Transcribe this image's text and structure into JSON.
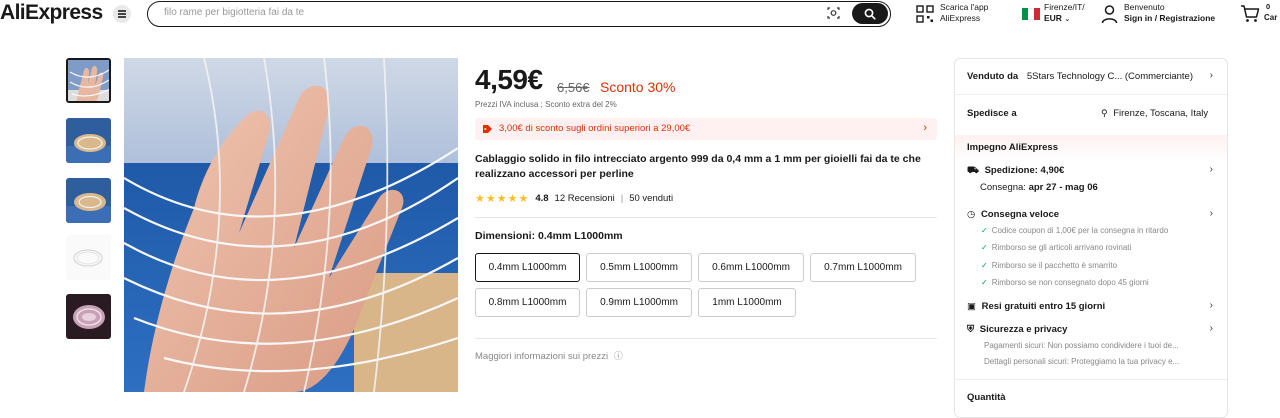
{
  "header": {
    "logo": "AliExpress",
    "search_placeholder": "filo rame per bigiotteria fai da te",
    "app_line1": "Scarica l'app",
    "app_line2": "AliExpress",
    "locale_line1": "Firenze/IT/",
    "locale_line2": "EUR",
    "account_line1": "Benvenuto",
    "account_line2": "Sign in / Registrazione",
    "cart_count": "0",
    "cart_label": "Car"
  },
  "product": {
    "price": "4,59€",
    "old_price": "6,56€",
    "discount": "Sconto 30%",
    "tax_note": "Prezzi IVA inclusa ; Sconto extra del 2%",
    "coupon": "3,00€ di sconto sugli ordini superiori a 29,00€",
    "title": "Cablaggio solido in filo intrecciato argento 999 da 0,4 mm a 1 mm per gioielli fai da te che realizzano accessori per perline",
    "rating": "4.8",
    "reviews": "12 Recensioni",
    "separator": "|",
    "sold": "50 venduti",
    "dimension_label": "Dimensioni: 0.4mm L1000mm",
    "options": [
      "0.4mm L1000mm",
      "0.5mm L1000mm",
      "0.6mm L1000mm",
      "0.7mm L1000mm",
      "0.8mm L1000mm",
      "0.9mm L1000mm",
      "1mm L1000mm"
    ],
    "more_info": "Maggiori informazioni sui prezzi"
  },
  "panel": {
    "sold_by_label": "Venduto da",
    "seller": "5Stars Technology C... (Commerciante)",
    "ships_to_label": "Spedisce a",
    "location": "Firenze, Toscana, Italy",
    "commitment": "Impegno AliExpress",
    "shipping": "Spedizione: 4,90€",
    "delivery_label": "Consegna:",
    "delivery_dates": "apr 27 - mag 06",
    "fast_delivery": "Consegna veloce",
    "fast_items": [
      "Codice coupon di 1,00€ per la consegna in ritardo",
      "Rimborso se gli articoli arrivano rovinati",
      "Rimborso se il pacchetto è smarrito",
      "Rimborso se non consegnato dopo 45 giorni"
    ],
    "free_returns": "Resi gratuiti entro 15 giorni",
    "security": "Sicurezza e privacy",
    "security_items": [
      "Pagamenti sicuri: Non possiamo condividere i tuoi de...",
      "Dettagli personali sicuri: Proteggiamo la tua privacy e..."
    ],
    "quantity": "Quantità"
  },
  "colors": {
    "accent_red": "#e62e04",
    "coupon_bg": "#fff0f1",
    "star": "#fdbd23",
    "check_green": "#00a651"
  }
}
